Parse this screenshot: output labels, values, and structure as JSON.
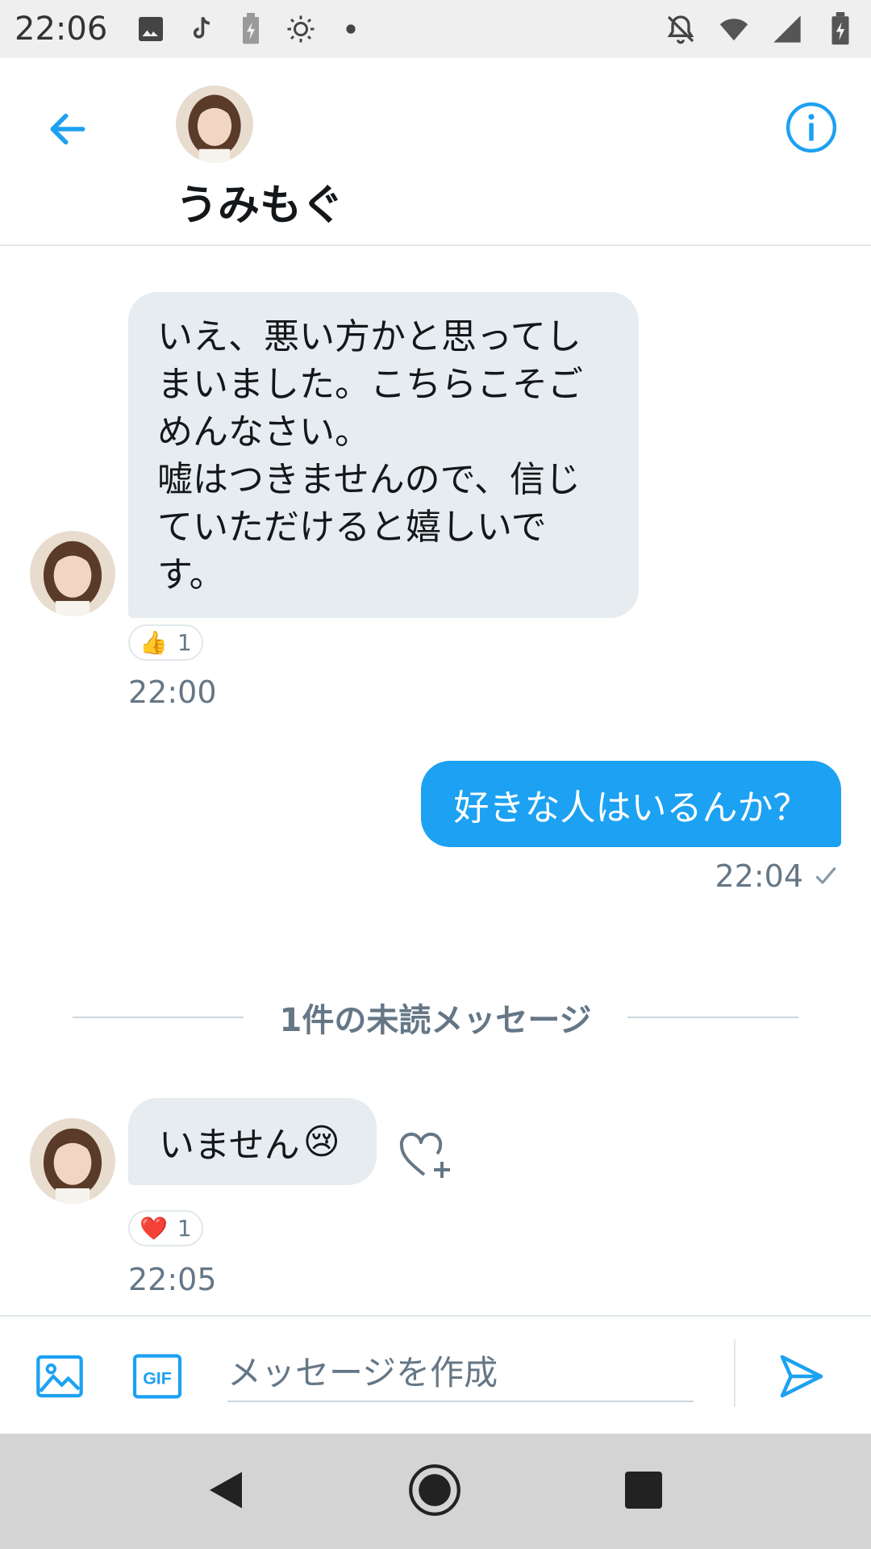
{
  "status_bar": {
    "time": "22:06",
    "left_icons": [
      "image-icon",
      "tiktok-icon",
      "battery-saver-icon",
      "brightness-icon",
      "dot-icon"
    ],
    "right_icons": [
      "notifications-off-icon",
      "wifi-icon",
      "signal-icon",
      "battery-charging-icon"
    ]
  },
  "header": {
    "contact_name": "うみもぐ",
    "back_icon": "arrow-left-icon",
    "info_icon": "info-icon"
  },
  "messages": [
    {
      "direction": "incoming",
      "text": "いえ、悪い方かと思ってし\nまいました。こちらこそご\nめんなさい。\n嘘はつきませんので、信じ\nていただけると嬉しいで\nす。",
      "reaction": {
        "emoji": "👍",
        "count": "1"
      },
      "time": "22:00"
    },
    {
      "direction": "outgoing",
      "text": "好きな人はいるんか？",
      "time": "22:04",
      "status_icon": "check-icon"
    },
    {
      "direction": "incoming",
      "text": "いません",
      "emoji": "😢",
      "reaction": {
        "emoji": "❤️",
        "count": "1"
      },
      "time": "22:05"
    }
  ],
  "unread_divider": "1件の未読メッセージ",
  "composer": {
    "placeholder": "メッセージを作成",
    "image_icon": "image-icon",
    "gif_label": "GIF",
    "send_icon": "send-icon"
  },
  "colors": {
    "accent": "#1da1f2",
    "bubble_in": "#e6ecf0",
    "secondary_text": "#657786",
    "divider": "#ccd6dd"
  }
}
